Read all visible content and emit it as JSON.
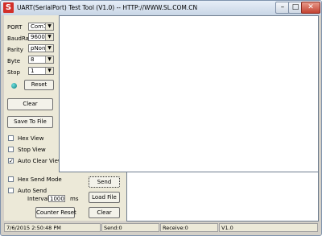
{
  "window": {
    "title": "UART(SerialPort) Test Tool (V1.0) -- HTTP://WWW.SL.COM.CN",
    "app_icon": "S"
  },
  "settings": {
    "port_label": "PORT",
    "port_value": "Com1",
    "baud_label": "BaudRa",
    "baud_value": "9600",
    "parity_label": "Parity",
    "parity_value": "pNone",
    "byte_label": "Byte",
    "byte_value": "8",
    "stop_label": "Stop",
    "stop_value": "1",
    "reset_label": "Reset"
  },
  "actions": {
    "clear_label": "Clear",
    "save_label": "Save To File"
  },
  "view_options": {
    "hex_view": "Hex View",
    "stop_view": "Stop View",
    "auto_clear_view": "Auto Clear View",
    "auto_clear_checked": "✓"
  },
  "send_panel": {
    "hex_send_mode": "Hex Send Mode",
    "auto_send": "Auto Send",
    "interval_label": "Interval",
    "interval_value": "1000",
    "interval_unit": "ms",
    "counter_reset": "Counter Reset",
    "send_label": "Send",
    "load_file_label": "Load File",
    "clear_label": "Clear"
  },
  "status": {
    "datetime": "7/6/2015 2:50:48 PM",
    "send": "Send:0",
    "receive": "Receive:0",
    "version": "V1.0"
  },
  "colors": {
    "close_button": "#c34231",
    "led": "#0d7b7b"
  }
}
